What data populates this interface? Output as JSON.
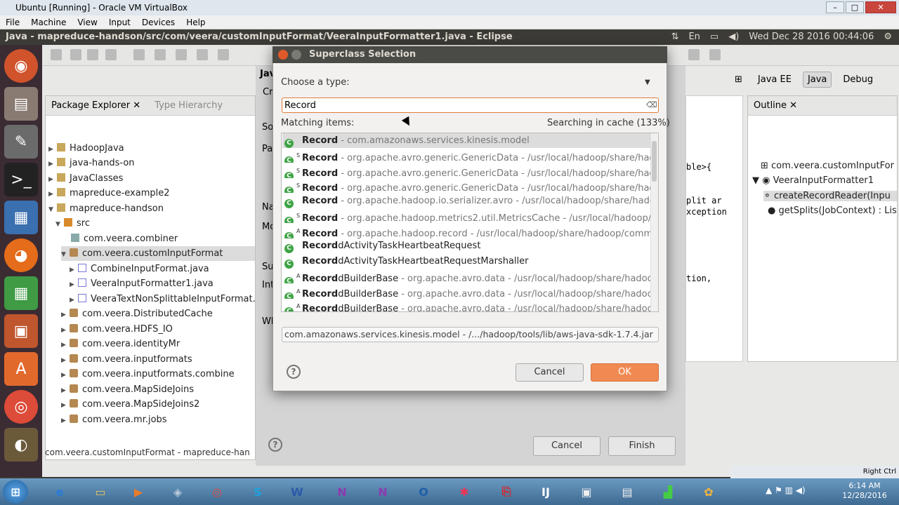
{
  "vbox": {
    "title": "Ubuntu [Running] - Oracle VM VirtualBox",
    "menu": [
      "File",
      "Machine",
      "View",
      "Input",
      "Devices",
      "Help"
    ],
    "status_right": "Right Ctrl"
  },
  "ubuntu_bar": {
    "window_title": "Java - mapreduce-handson/src/com/veera/customInputFormat/VeeraInputFormatter1.java - Eclipse",
    "keyboard": "En",
    "datetime": "Wed Dec 28 2016 00:44:06"
  },
  "perspectives": [
    "Java EE",
    "Java",
    "Debug"
  ],
  "package_explorer": {
    "tab_label": "Package Explorer",
    "tab2_label": "Type Hierarchy",
    "items": [
      {
        "label": "HadoopJava"
      },
      {
        "label": "java-hands-on"
      },
      {
        "label": "JavaClasses"
      },
      {
        "label": "mapreduce-example2"
      },
      {
        "label": "mapreduce-handson"
      },
      {
        "label": "src"
      },
      {
        "label": "com.veera.combiner"
      },
      {
        "label": "com.veera.customInputFormat"
      },
      {
        "label": "CombineInputFormat.java"
      },
      {
        "label": "VeeraInputFormatter1.java"
      },
      {
        "label": "VeeraTextNonSplittableInputFormat."
      },
      {
        "label": "com.veera.DistributedCache"
      },
      {
        "label": "com.veera.HDFS_IO"
      },
      {
        "label": "com.veera.identityMr"
      },
      {
        "label": "com.veera.inputformats"
      },
      {
        "label": "com.veera.inputformats.combine"
      },
      {
        "label": "com.veera.MapSideJoins"
      },
      {
        "label": "com.veera.MapSideJoins2"
      },
      {
        "label": "com.veera.mr.jobs"
      }
    ],
    "status": "com.veera.customInputFormat - mapreduce-han"
  },
  "editor": {
    "lines": [
      "ble>{",
      "plit ar",
      "xception",
      "tion,"
    ]
  },
  "outline": {
    "tab_label": "Outline",
    "items": [
      {
        "label": "com.veera.customInputFor"
      },
      {
        "label": "VeeraInputFormatter1"
      },
      {
        "label": "createRecordReader(Inpu"
      },
      {
        "label": "getSplits(JobContext) : Lis"
      }
    ]
  },
  "wizard": {
    "partial_labels": [
      "Java",
      "Cr",
      "So",
      "Pa",
      "Na",
      "Mo",
      "Su",
      "Int",
      "Wh"
    ],
    "cancel": "Cancel",
    "finish": "Finish"
  },
  "dialog": {
    "title": "Superclass Selection",
    "choose_label": "Choose a type:",
    "input_value": "Record",
    "matching_label": "Matching items:",
    "searching_status": "Searching in cache (133%)",
    "results": [
      {
        "name": "Record",
        "rest": "",
        "pkg": " - com.amazonaws.services.kinesis.model",
        "sup": ""
      },
      {
        "name": "Record",
        "rest": "",
        "pkg": " - org.apache.avro.generic.GenericData - /usr/local/hadoop/share/hadoo",
        "sup": "S"
      },
      {
        "name": "Record",
        "rest": "",
        "pkg": " - org.apache.avro.generic.GenericData - /usr/local/hadoop/share/hadoo",
        "sup": "S"
      },
      {
        "name": "Record",
        "rest": "",
        "pkg": " - org.apache.avro.generic.GenericData - /usr/local/hadoop/share/hadoo",
        "sup": "S"
      },
      {
        "name": "Record",
        "rest": "",
        "pkg": " - org.apache.hadoop.io.serializer.avro - /usr/local/hadoop/share/hadoo",
        "sup": ""
      },
      {
        "name": "Record",
        "rest": "",
        "pkg": " - org.apache.hadoop.metrics2.util.MetricsCache - /usr/local/hadoop/sha",
        "sup": "S"
      },
      {
        "name": "Record",
        "rest": "",
        "pkg": " - org.apache.hadoop.record - /usr/local/hadoop/share/hadoop/commo",
        "sup": "A"
      },
      {
        "name": "Record",
        "rest": "dActivityTaskHeartbeatRequest",
        "pkg": "",
        "sup": ""
      },
      {
        "name": "Record",
        "rest": "dActivityTaskHeartbeatRequestMarshaller",
        "pkg": "",
        "sup": ""
      },
      {
        "name": "Record",
        "rest": "dBuilderBase",
        "pkg": " - org.apache.avro.data - /usr/local/hadoop/share/hadoop/c",
        "sup": "A"
      },
      {
        "name": "Record",
        "rest": "dBuilderBase",
        "pkg": " - org.apache.avro.data - /usr/local/hadoop/share/hadoop/m",
        "sup": "A"
      },
      {
        "name": "Record",
        "rest": "dBuilderBase",
        "pkg": " - org.apache.avro.data - /usr/local/hadoop/share/hadoop/t",
        "sup": "A"
      }
    ],
    "qualifier": "com.amazonaws.services.kinesis.model - /.../hadoop/tools/lib/aws-java-sdk-1.7.4.jar",
    "cancel": "Cancel",
    "ok": "OK"
  },
  "taskbar": {
    "time": "6:14 AM",
    "date": "12/28/2016"
  }
}
